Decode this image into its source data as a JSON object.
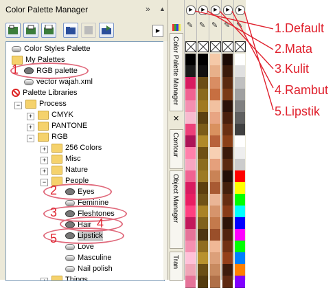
{
  "titlebar": {
    "title": "Color Palette Manager",
    "collapse": "»",
    "up": "▲",
    "close": "✕"
  },
  "dock": {
    "tab_palette": "Color Palette Manager",
    "tab_contour": "Contour",
    "tab_object": "Object Manager",
    "tab_transform": "Tran"
  },
  "tree": {
    "items": [
      {
        "label": "Color Styles Palette",
        "level": 0,
        "icon": "palette-icon"
      },
      {
        "label": "My Palettes",
        "level": 0,
        "icon": "folder-icon",
        "expanded": true
      },
      {
        "label": "RGB palette",
        "level": 1,
        "icon": "eye-icon"
      },
      {
        "label": "vector wajah.xml",
        "level": 1,
        "icon": "palette-icon"
      },
      {
        "label": "Palette Libraries",
        "level": 0,
        "icon": "no-icon"
      },
      {
        "label": "Process",
        "level": 1,
        "icon": "folder-icon",
        "expanded": true
      },
      {
        "label": "CMYK",
        "level": 2,
        "icon": "folder-icon",
        "collapsed": true
      },
      {
        "label": "PANTONE",
        "level": 2,
        "icon": "folder-icon",
        "collapsed": true
      },
      {
        "label": "RGB",
        "level": 2,
        "icon": "folder-icon",
        "expanded": true
      },
      {
        "label": "256 Colors",
        "level": 3,
        "icon": "folder-icon",
        "collapsed": true
      },
      {
        "label": "Misc",
        "level": 3,
        "icon": "folder-icon",
        "collapsed": true
      },
      {
        "label": "Nature",
        "level": 3,
        "icon": "folder-icon",
        "collapsed": true
      },
      {
        "label": "People",
        "level": 3,
        "icon": "folder-icon",
        "expanded": true
      },
      {
        "label": "Eyes",
        "level": 4,
        "icon": "eye-icon"
      },
      {
        "label": "Feminine",
        "level": 4,
        "icon": "palette-icon"
      },
      {
        "label": "Fleshtones",
        "level": 4,
        "icon": "eye-icon"
      },
      {
        "label": "Hair",
        "level": 4,
        "icon": "eye-icon"
      },
      {
        "label": "Lipstick",
        "level": 4,
        "icon": "eye-icon",
        "selected": true
      },
      {
        "label": "Love",
        "level": 4,
        "icon": "palette-icon"
      },
      {
        "label": "Masculine",
        "level": 4,
        "icon": "palette-icon"
      },
      {
        "label": "Nail polish",
        "level": 4,
        "icon": "palette-icon"
      },
      {
        "label": "Things",
        "level": 3,
        "icon": "folder-icon",
        "collapsed": true
      }
    ]
  },
  "annotations": {
    "n1": "1",
    "n2": "2",
    "n3": "3",
    "n4": "4",
    "n5": "5",
    "labels": [
      "1.Default",
      "2.Mata",
      "3.Kulit",
      "4.Rambut",
      "5.Lipstik"
    ]
  },
  "palettes": [
    {
      "name": "default",
      "colors": [
        "#000000",
        "#1a1a1a",
        "#d81b60",
        "#f06292",
        "#f48fb1",
        "#f8bbd0",
        "#ec407a",
        "#ad1457",
        "#ff80ab",
        "#f8a5c2",
        "#f06292",
        "#d81b60",
        "#e91e63",
        "#ff4081",
        "#c2185b",
        "#e57399",
        "#f48fb1",
        "#ffc1d9",
        "#f0a5b7",
        "#e57399"
      ]
    },
    {
      "name": "eyes",
      "colors": [
        "#000000",
        "#111111",
        "#6b4e16",
        "#8a6a1e",
        "#a07a22",
        "#5a4010",
        "#7b5c18",
        "#b08a2a",
        "#6e5014",
        "#8c6c20",
        "#9c7a25",
        "#5c3f0e",
        "#6f5317",
        "#a98326",
        "#7f611b",
        "#4d3510",
        "#8f6d20",
        "#b8922e",
        "#6a4e15",
        "#543b0f"
      ]
    },
    {
      "name": "flesh",
      "colors": [
        "#f5c9a8",
        "#e8b08a",
        "#d98d63",
        "#c76f41",
        "#f2c1a0",
        "#e8a583",
        "#d9915f",
        "#b8623a",
        "#f7d0b3",
        "#e5a07c",
        "#c98356",
        "#a85a33",
        "#eab596",
        "#d6946c",
        "#c47a4c",
        "#9a4f2a",
        "#f0b896",
        "#dca07a",
        "#c88a60",
        "#b07048"
      ]
    },
    {
      "name": "hair",
      "colors": [
        "#1a0a05",
        "#3a1a0a",
        "#5a2a10",
        "#7a3a15",
        "#2a1208",
        "#4a200c",
        "#6a3012",
        "#8a4018",
        "#3a1a0a",
        "#5a2a10",
        "#220e06",
        "#44200c",
        "#662e12",
        "#883c18",
        "#2e1408",
        "#50240e",
        "#723214",
        "#94401a",
        "#3e1c0c",
        "#602a12"
      ]
    },
    {
      "name": "lipstick",
      "colors": [
        "#ffffff",
        "#e0e0e0",
        "#c0c0c0",
        "#a0a0a0",
        "#808080",
        "#606060",
        "#404040",
        "#ffffff",
        "#eeeeee",
        "#cccccc",
        "#ff0000",
        "#ffff00",
        "#00ff00",
        "#00ffff",
        "#0000ff",
        "#ff00ff",
        "#00ff00",
        "#0080ff",
        "#ff8000",
        "#8000ff"
      ]
    }
  ]
}
